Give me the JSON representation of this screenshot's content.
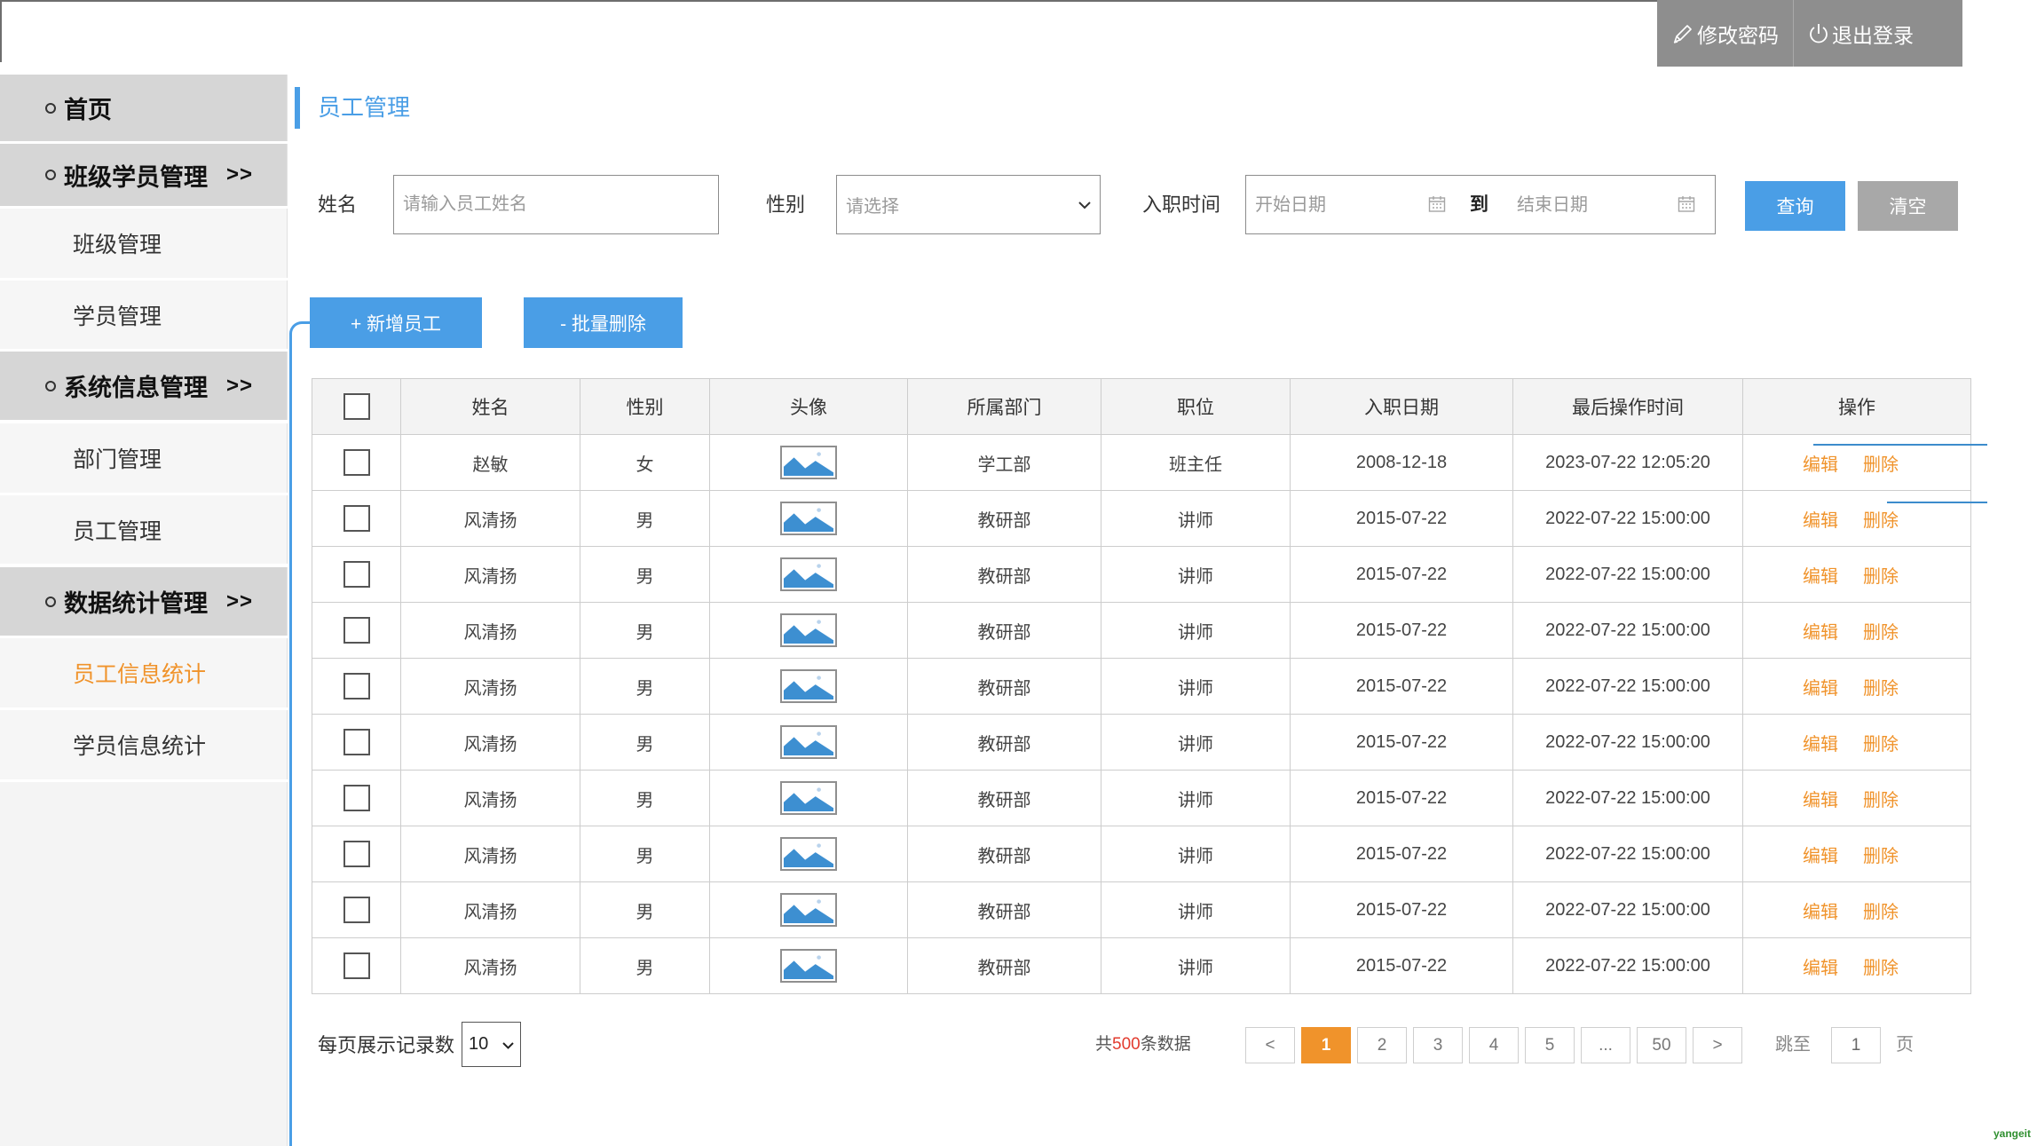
{
  "header": {
    "change_password": "修改密码",
    "logout": "退出登录"
  },
  "sidebar": {
    "items": [
      {
        "label": "首页",
        "type": "group"
      },
      {
        "label": "班级学员管理",
        "type": "group",
        "arrow": ">>"
      },
      {
        "label": "班级管理",
        "type": "item"
      },
      {
        "label": "学员管理",
        "type": "item"
      },
      {
        "label": "系统信息管理",
        "type": "group",
        "arrow": ">>"
      },
      {
        "label": "部门管理",
        "type": "item"
      },
      {
        "label": "员工管理",
        "type": "item"
      },
      {
        "label": "数据统计管理",
        "type": "group",
        "arrow": ">>"
      },
      {
        "label": "员工信息统计",
        "type": "item",
        "active": true
      },
      {
        "label": "学员信息统计",
        "type": "item"
      }
    ]
  },
  "page": {
    "title": "员工管理"
  },
  "filters": {
    "name_label": "姓名",
    "name_placeholder": "请输入员工姓名",
    "gender_label": "性别",
    "gender_placeholder": "请选择",
    "date_label": "入职时间",
    "start_placeholder": "开始日期",
    "to": "到",
    "end_placeholder": "结束日期",
    "query": "查询",
    "clear": "清空"
  },
  "actions": {
    "add": "+ 新增员工",
    "batch_delete": "- 批量删除"
  },
  "table": {
    "columns": [
      "姓名",
      "性别",
      "头像",
      "所属部门",
      "职位",
      "入职日期",
      "最后操作时间",
      "操作"
    ],
    "edit_label": "编辑",
    "delete_label": "删除",
    "rows": [
      {
        "name": "赵敏",
        "gender": "女",
        "dept": "学工部",
        "position": "班主任",
        "join_date": "2008-12-18",
        "last_op": "2023-07-22 12:05:20"
      },
      {
        "name": "风清扬",
        "gender": "男",
        "dept": "教研部",
        "position": "讲师",
        "join_date": "2015-07-22",
        "last_op": "2022-07-22 15:00:00"
      },
      {
        "name": "风清扬",
        "gender": "男",
        "dept": "教研部",
        "position": "讲师",
        "join_date": "2015-07-22",
        "last_op": "2022-07-22 15:00:00"
      },
      {
        "name": "风清扬",
        "gender": "男",
        "dept": "教研部",
        "position": "讲师",
        "join_date": "2015-07-22",
        "last_op": "2022-07-22 15:00:00"
      },
      {
        "name": "风清扬",
        "gender": "男",
        "dept": "教研部",
        "position": "讲师",
        "join_date": "2015-07-22",
        "last_op": "2022-07-22 15:00:00"
      },
      {
        "name": "风清扬",
        "gender": "男",
        "dept": "教研部",
        "position": "讲师",
        "join_date": "2015-07-22",
        "last_op": "2022-07-22 15:00:00"
      },
      {
        "name": "风清扬",
        "gender": "男",
        "dept": "教研部",
        "position": "讲师",
        "join_date": "2015-07-22",
        "last_op": "2022-07-22 15:00:00"
      },
      {
        "name": "风清扬",
        "gender": "男",
        "dept": "教研部",
        "position": "讲师",
        "join_date": "2015-07-22",
        "last_op": "2022-07-22 15:00:00"
      },
      {
        "name": "风清扬",
        "gender": "男",
        "dept": "教研部",
        "position": "讲师",
        "join_date": "2015-07-22",
        "last_op": "2022-07-22 15:00:00"
      },
      {
        "name": "风清扬",
        "gender": "男",
        "dept": "教研部",
        "position": "讲师",
        "join_date": "2015-07-22",
        "last_op": "2022-07-22 15:00:00"
      }
    ]
  },
  "pagination": {
    "per_page_label": "每页展示记录数",
    "per_page": "10",
    "total_prefix": "共",
    "total": "500",
    "total_suffix": "条数据",
    "prev": "<",
    "pages": [
      "1",
      "2",
      "3",
      "4",
      "5",
      "...",
      "50"
    ],
    "current": "1",
    "next": ">",
    "jump_label": "跳至",
    "jump_value": "1",
    "page_suffix": "页"
  },
  "watermark": "yangeit",
  "colors": {
    "accent": "#4a9ee6",
    "highlight": "#f0932b",
    "total_number": "#e23b2e",
    "clear_button": "#a8a8a8"
  }
}
